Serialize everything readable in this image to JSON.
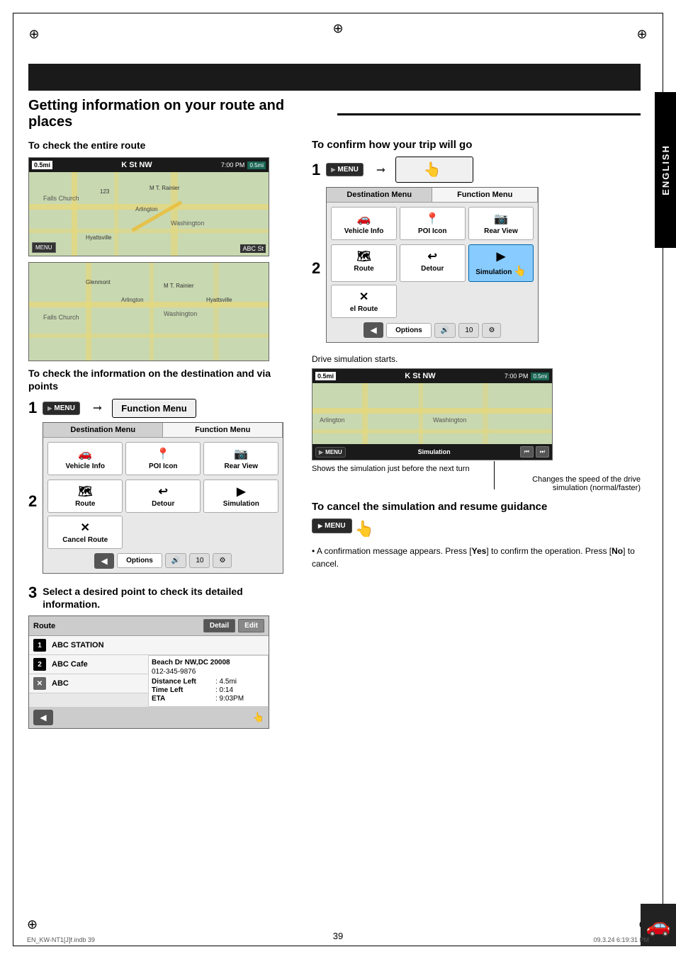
{
  "page": {
    "title": "Getting information on your route and places",
    "number": "39",
    "footer_left": "EN_KW-NT1[J]f.indb   39",
    "footer_right": "09.3.24   6:19:31 PM",
    "sidebar_label": "ENGLISH"
  },
  "left_section": {
    "check_entire_route_title": "To check the entire route",
    "check_info_title": "To check the information on the destination and via points",
    "step1_label": "1",
    "step2_label": "2",
    "step3_label": "3",
    "menu_btn_label": "MENU",
    "arrow": "➞",
    "function_menu_label": "Function Menu",
    "step3_text": "Select a desired point to check its detailed information.",
    "dest_menu": {
      "tab1": "Destination Menu",
      "tab2": "Function Menu",
      "items_row1": [
        {
          "label": "Vehicle Info",
          "icon": "🚗"
        },
        {
          "label": "POI Icon",
          "icon": "📍"
        },
        {
          "label": "Rear View",
          "icon": "📷"
        }
      ],
      "items_row2": [
        {
          "label": "Route",
          "icon": "🗺"
        },
        {
          "label": "Detour",
          "icon": "↩"
        },
        {
          "label": "Simulation",
          "icon": "▶"
        },
        {
          "label": "Cancel Route",
          "icon": "✕"
        }
      ],
      "options_label": "Options",
      "num_label": "10"
    },
    "route_screen": {
      "title": "Route",
      "detail_btn": "Detail",
      "edit_btn": "Edit",
      "items": [
        {
          "num": "1",
          "name": "ABC STATION"
        },
        {
          "num": "2",
          "name": "ABC Cafe"
        },
        {
          "num": "✕",
          "name": "ABC"
        }
      ],
      "detail": {
        "address": "Beach Dr NW,DC 20008",
        "phone": "012-345-9876",
        "distance_label": "Distance Left",
        "distance_val": ": 4.5mi",
        "time_label": "Time Left",
        "time_val": ": 0:14",
        "eta_label": "ETA",
        "eta_val": ": 9:03PM"
      }
    }
  },
  "right_section": {
    "confirm_trip_title": "To confirm how your trip will go",
    "step1_label": "1",
    "step2_label": "2",
    "menu_btn_label": "MENU",
    "function_menu_label": "Function Menu",
    "drive_sim_label": "Drive simulation starts.",
    "sim_note1": "Shows the simulation just before the next turn",
    "sim_note2": "Changes the speed of the drive simulation (normal/faster)",
    "cancel_section": {
      "title": "To cancel the simulation and resume guidance",
      "menu_btn_label": "MENU",
      "bullet": "A confirmation message appears. Press [Yes] to confirm the operation. Press [No] to cancel.",
      "yes_label": "Yes",
      "no_label": "No"
    },
    "dest_menu": {
      "tab1": "Destination Menu",
      "tab2": "Function Menu",
      "items_row1": [
        {
          "label": "Vehicle Info",
          "icon": "🚗"
        },
        {
          "label": "POI Icon",
          "icon": "📍"
        },
        {
          "label": "Rear View",
          "icon": "📷"
        }
      ],
      "items_row2": [
        {
          "label": "Route",
          "icon": "🗺"
        },
        {
          "label": "Detour",
          "icon": "↩"
        },
        {
          "label": "Simulation",
          "icon": "▶",
          "highlight": true
        },
        {
          "label": "el Route",
          "icon": "✕"
        }
      ],
      "options_label": "Options",
      "num_label": "10"
    }
  },
  "map_labels": {
    "dist1": "0.5mi",
    "street1": "K St NW",
    "time1": "7:00 PM",
    "dist2": "0.5mi",
    "menu": "MENU",
    "abc_st": "ABC St",
    "simulation_label": "Simulation"
  },
  "icons": {
    "crosshair": "⊕",
    "back_arrow": "◀",
    "hand": "👆",
    "menu_arrow": "▶"
  }
}
